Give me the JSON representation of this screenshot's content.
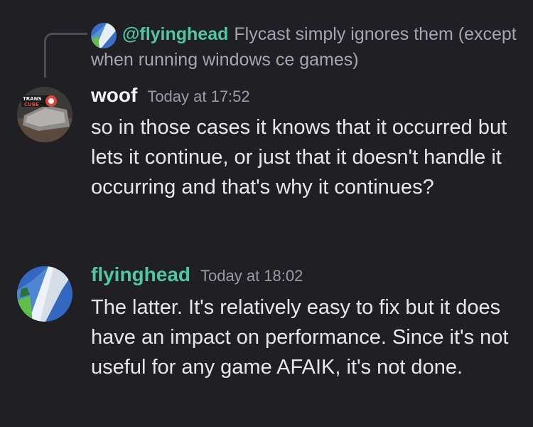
{
  "reply": {
    "author": "@flyinghead",
    "text": "Flycast simply ignores them (except when running windows ce games)"
  },
  "messages": [
    {
      "author": "woof",
      "timestamp": "Today at 17:52",
      "text": "so in those cases it knows that it occurred but lets it continue, or just that it doesn't handle it occurring and that's why it continues?",
      "avatar_label": "TRANS CUBE"
    },
    {
      "author": "flyinghead",
      "timestamp": "Today at 18:02",
      "text": "The latter. It's relatively easy to fix but it does have an impact on performance. Since it's not useful for any game AFAIK, it's not done."
    }
  ],
  "colors": {
    "background": "#1f1f24",
    "author_green": "#4fc7a1",
    "timestamp": "#9a9ca4",
    "text": "#e6e7ea"
  }
}
